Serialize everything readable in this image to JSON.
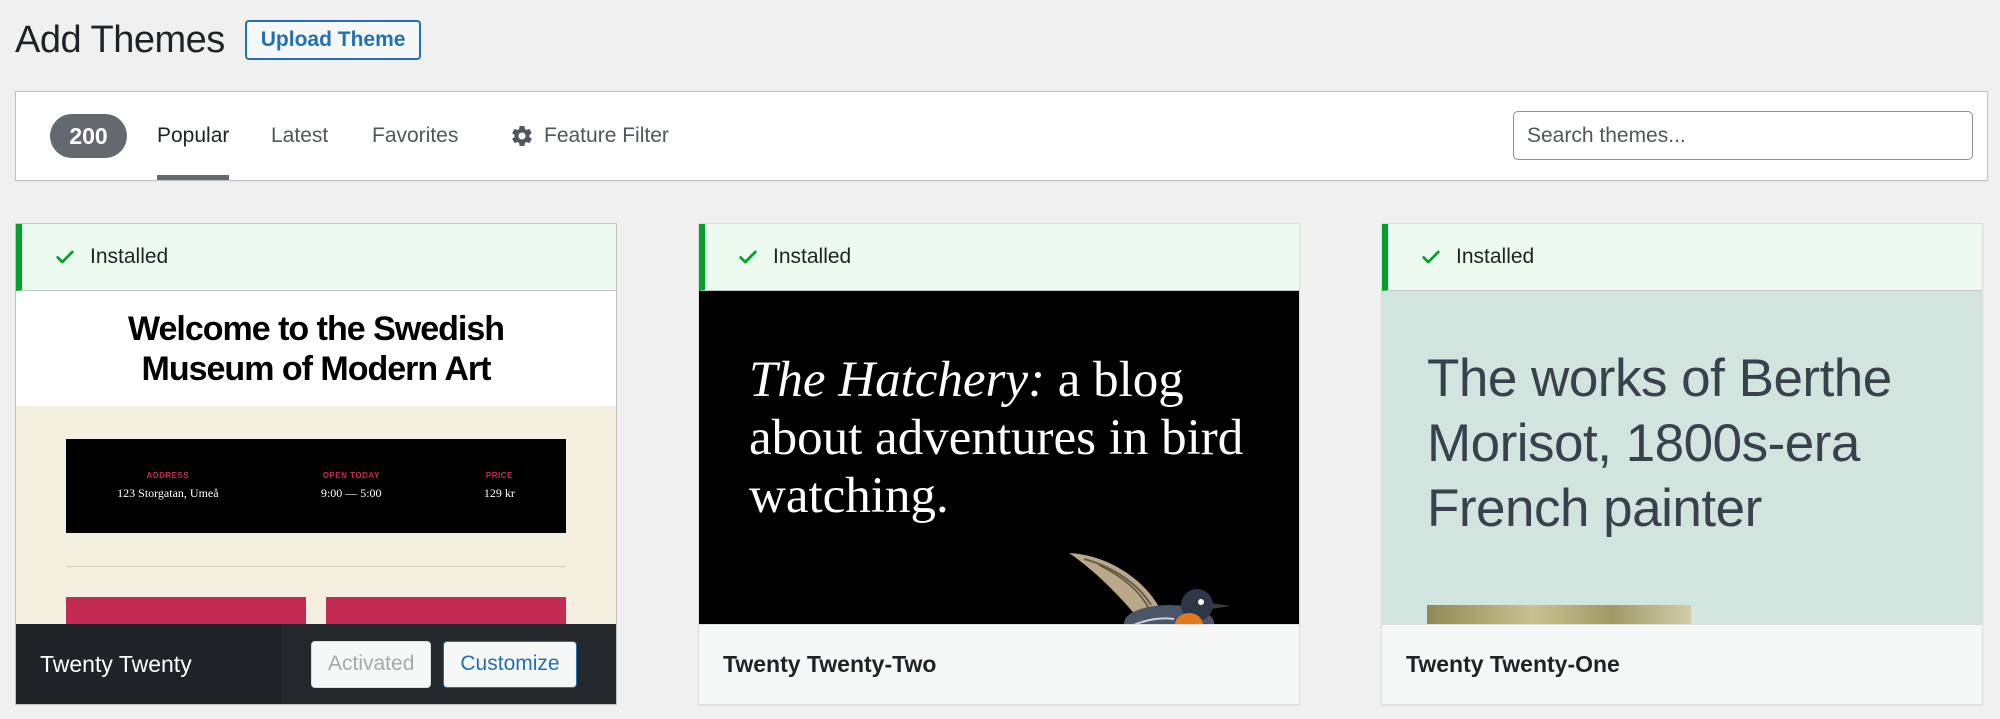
{
  "header": {
    "title": "Add Themes",
    "upload_label": "Upload Theme"
  },
  "filter_bar": {
    "count": "200",
    "tabs": [
      {
        "label": "Popular",
        "current": true
      },
      {
        "label": "Latest",
        "current": false
      },
      {
        "label": "Favorites",
        "current": false
      }
    ],
    "feature_filter_label": "Feature Filter",
    "search_placeholder": "Search themes..."
  },
  "themes": [
    {
      "name": "Twenty Twenty",
      "status": "Installed",
      "activated_label": "Activated",
      "customize_label": "Customize",
      "preview": {
        "heading": "Welcome to the Swedish Museum of Modern Art",
        "info": [
          {
            "label": "ADDRESS",
            "value": "123 Storgatan, Umeå"
          },
          {
            "label": "OPEN TODAY",
            "value": "9:00 — 5:00"
          },
          {
            "label": "PRICE",
            "value": "129 kr"
          }
        ]
      }
    },
    {
      "name": "Twenty Twenty-Two",
      "status": "Installed",
      "preview": {
        "italic": "The Hatchery:",
        "text": " a blog about adventures in bird watching."
      }
    },
    {
      "name": "Twenty Twenty-One",
      "status": "Installed",
      "preview": {
        "text": "The works of Berthe Morisot, 1800s-era French painter"
      }
    }
  ],
  "colors": {
    "accent": "#2271b1",
    "installed_green": "#00a32a",
    "installed_bg": "#edfaef",
    "badge_gray": "#646970"
  }
}
